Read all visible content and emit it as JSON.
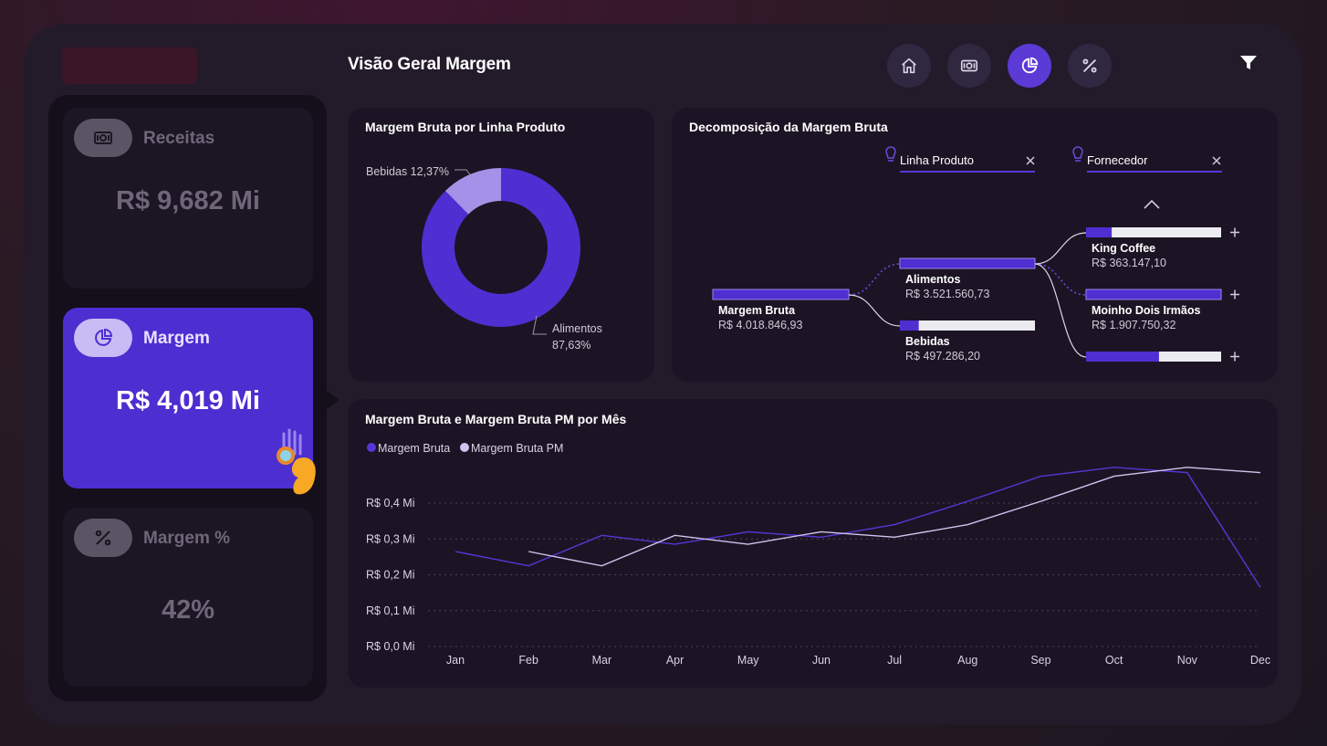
{
  "header": {
    "title": "Visão Geral Margem"
  },
  "nav": [
    {
      "icon": "home-icon",
      "active": false
    },
    {
      "icon": "money-icon",
      "active": false
    },
    {
      "icon": "pie-chart-icon",
      "active": true
    },
    {
      "icon": "percent-icon",
      "active": false
    }
  ],
  "kpis": {
    "receitas": {
      "label": "Receitas",
      "value": "R$ 9,682 Mi"
    },
    "margem": {
      "label": "Margem",
      "value": "R$ 4,019 Mi"
    },
    "margem_pct": {
      "label": "Margem %",
      "value": "42%"
    }
  },
  "donut": {
    "title": "Margem Bruta por Linha Produto",
    "label_bebidas": "Bebidas 12,37%",
    "label_alimentos_name": "Alimentos",
    "label_alimentos_pct": "87,63%",
    "colors": {
      "Alimentos": "#4f2fd2",
      "Bebidas": "#a592e8"
    }
  },
  "decomp": {
    "title": "Decomposição da Margem Bruta",
    "filter1": "Linha Produto",
    "filter2": "Fornecedor",
    "root": {
      "name": "Margem Bruta",
      "value": "R$ 4.018.846,93"
    },
    "level1": [
      {
        "name": "Alimentos",
        "value": "R$ 3.521.560,73",
        "fill": 1.0
      },
      {
        "name": "Bebidas",
        "value": "R$ 497.286,20",
        "fill": 0.14
      }
    ],
    "level2": [
      {
        "name": "King Coffee",
        "value": "R$ 363.147,10",
        "fill": 0.19
      },
      {
        "name": "Moinho Dois Irmãos",
        "value": "R$ 1.907.750,32",
        "fill": 1.0
      },
      {
        "name": "",
        "value": "",
        "fill": 0.54
      }
    ]
  },
  "line": {
    "title": "Margem Bruta e Margem Bruta PM por Mês",
    "legend": [
      "Margem Bruta",
      "Margem Bruta PM"
    ],
    "colors": [
      "#5a35d8",
      "#cfc4ee"
    ]
  },
  "chart_data": {
    "type": "line",
    "title": "Margem Bruta e Margem Bruta PM por Mês",
    "x": [
      "Jan",
      "Feb",
      "Mar",
      "Apr",
      "May",
      "Jun",
      "Jul",
      "Aug",
      "Sep",
      "Oct",
      "Nov",
      "Dec"
    ],
    "series": [
      {
        "name": "Margem Bruta",
        "values": [
          0.265,
          0.225,
          0.31,
          0.285,
          0.32,
          0.305,
          0.34,
          0.405,
          0.475,
          0.5,
          0.485,
          0.165
        ]
      },
      {
        "name": "Margem Bruta PM",
        "values": [
          null,
          0.265,
          0.225,
          0.31,
          0.285,
          0.32,
          0.305,
          0.34,
          0.405,
          0.475,
          0.5,
          0.485
        ]
      }
    ],
    "yticks": [
      "R$ 0,0 Mi",
      "R$ 0,1 Mi",
      "R$ 0,2 Mi",
      "R$ 0,3 Mi",
      "R$ 0,4 Mi"
    ],
    "ylim": [
      0,
      0.4
    ],
    "grid": true,
    "legend_position": "top-left"
  }
}
